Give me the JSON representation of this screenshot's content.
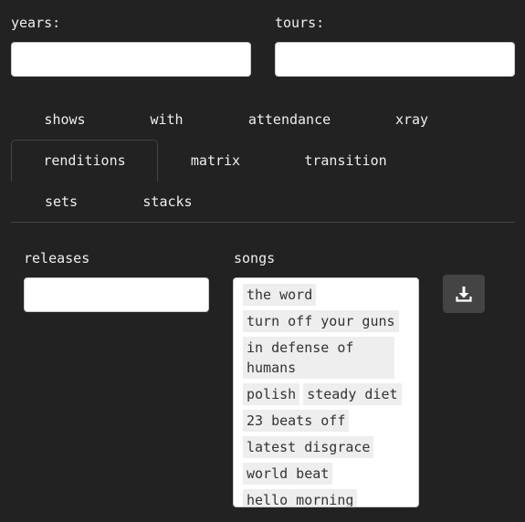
{
  "filters": {
    "years_label": "years:",
    "years_value": "",
    "tours_label": "tours:",
    "tours_value": ""
  },
  "tabs": [
    {
      "label": "shows"
    },
    {
      "label": "with"
    },
    {
      "label": "attendance"
    },
    {
      "label": "xray"
    },
    {
      "label": "renditions",
      "active": true
    },
    {
      "label": "matrix"
    },
    {
      "label": "transition"
    },
    {
      "label": "sets"
    },
    {
      "label": "stacks"
    }
  ],
  "panel": {
    "releases_label": "releases",
    "releases_value": "",
    "songs_label": "songs",
    "songs": [
      "the word",
      "turn off your guns",
      "in defense of humans",
      "polish",
      "steady diet",
      "23 beats off",
      "latest disgrace",
      "world beat",
      "hello morning"
    ],
    "download_icon": "download-icon"
  }
}
